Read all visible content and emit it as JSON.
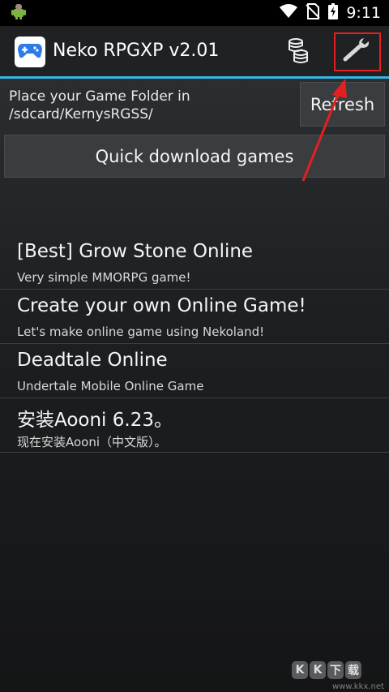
{
  "status_bar": {
    "time": "9:11",
    "icons": [
      "android-debug-icon",
      "wifi-icon",
      "no-sim-icon",
      "battery-charging-icon"
    ]
  },
  "action_bar": {
    "app_icon": "gamepad-icon",
    "title": "Neko RPGXP v2.01",
    "coins_icon": "coins-icon",
    "settings_icon": "wrench-icon",
    "highlight_color": "#e51f1f",
    "accent_color": "#33b5e5"
  },
  "folder_info": {
    "line1": "Place your Game Folder in",
    "line2": "/sdcard/KernysRGSS/"
  },
  "buttons": {
    "refresh_label": "Refresh",
    "quick_download_label": "Quick download games"
  },
  "games": [
    {
      "title": "[Best] Grow Stone Online",
      "subtitle": "Very simple MMORPG game!"
    },
    {
      "title": "Create your own Online Game!",
      "subtitle": "Let's make online game using Nekoland!"
    },
    {
      "title": "Deadtale Online",
      "subtitle": "Undertale Mobile Online Game"
    },
    {
      "title": "安装Aooni 6.23。",
      "subtitle": "现在安装Aooni（中文版）。"
    }
  ],
  "watermark": {
    "chars": [
      "K",
      "K",
      "下",
      "载"
    ],
    "url": "www.kkx.net"
  }
}
